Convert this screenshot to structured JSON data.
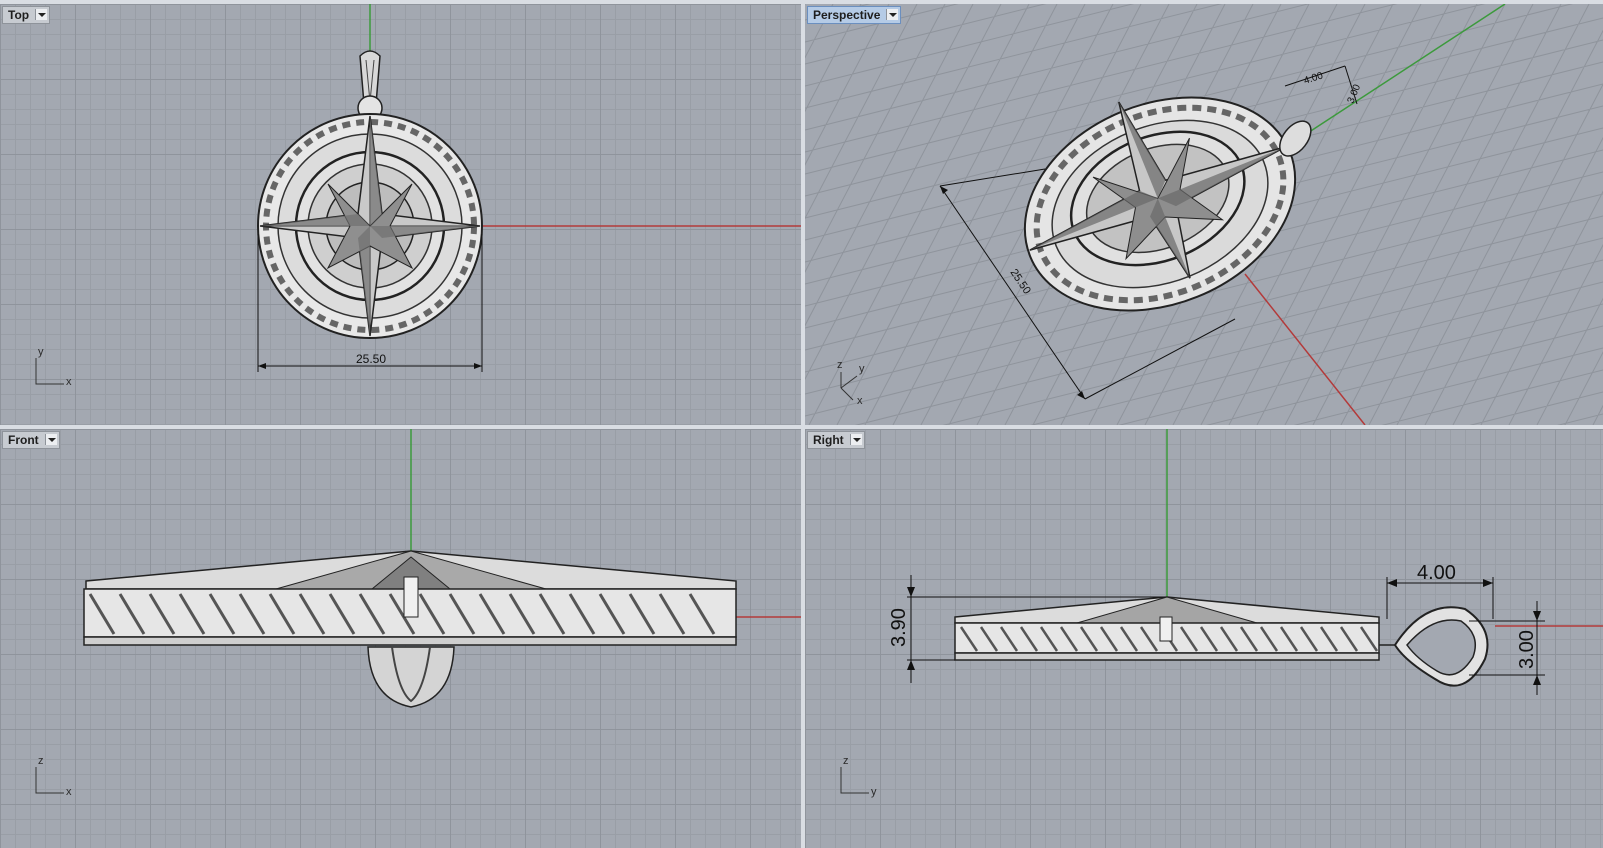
{
  "viewports": {
    "top": {
      "label": "Top",
      "axis_h": "x",
      "axis_v": "y",
      "dimension": "25.50"
    },
    "perspective": {
      "label": "Perspective",
      "axis_1": "z",
      "axis_2": "y",
      "axis_3": "x",
      "dimension_diameter": "25.50",
      "dimension_bail": "4.00",
      "dimension_bail_h": "3.00"
    },
    "front": {
      "label": "Front",
      "axis_h": "x",
      "axis_v": "z"
    },
    "right": {
      "label": "Right",
      "axis_h": "y",
      "axis_v": "z",
      "dimension_height": "3.90",
      "dimension_bail_w": "4.00",
      "dimension_bail_h": "3.00"
    }
  },
  "colors": {
    "viewport_bg": "#a3a8b1",
    "grid_minor": "#999ea6",
    "grid_major": "#8f949c",
    "x_axis": "#b33a3a",
    "y_axis": "#3c9a3c",
    "active_label": "#b5cbe6"
  }
}
